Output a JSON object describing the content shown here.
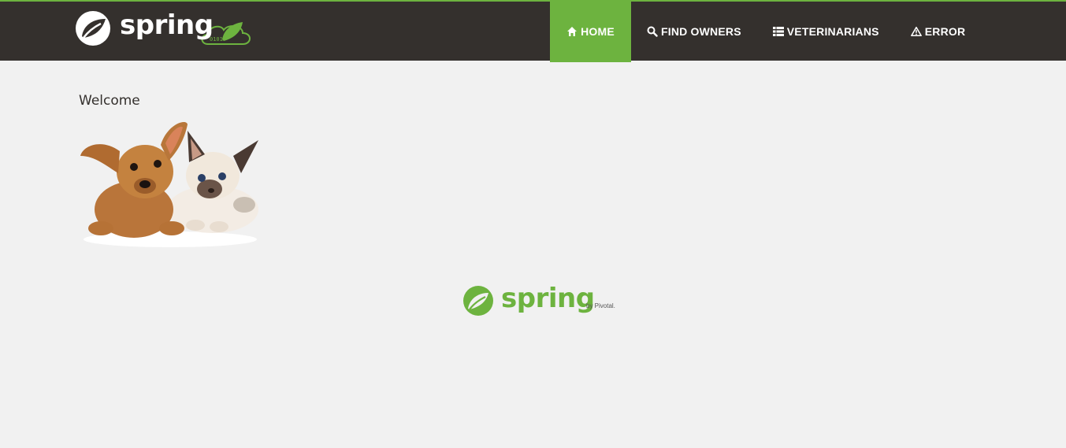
{
  "brand": {
    "wordmark": "spring",
    "badge_text": "0101"
  },
  "nav": {
    "items": [
      {
        "label": "HOME",
        "icon": "home-icon",
        "active": true
      },
      {
        "label": "FIND OWNERS",
        "icon": "search-icon",
        "active": false
      },
      {
        "label": "VETERINARIANS",
        "icon": "list-icon",
        "active": false
      },
      {
        "label": "ERROR",
        "icon": "warning-icon",
        "active": false
      }
    ]
  },
  "main": {
    "heading": "Welcome",
    "image": "pets-image"
  },
  "footer": {
    "wordmark": "spring",
    "byline": "by Pivotal."
  },
  "colors": {
    "navbar": "#34302d",
    "accent": "#6db33f",
    "background": "#f1f1f1"
  }
}
